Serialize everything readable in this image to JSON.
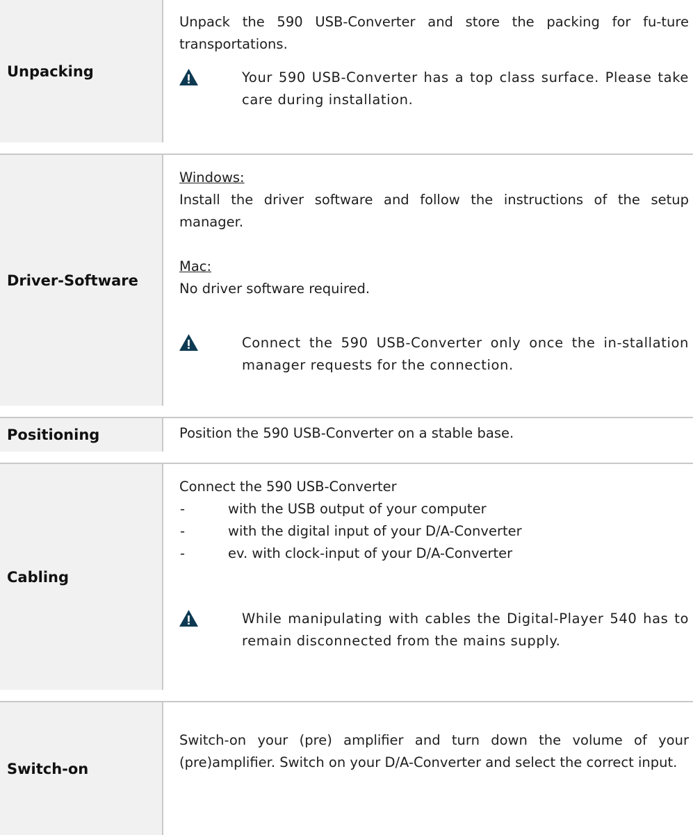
{
  "sections": {
    "unpacking": {
      "title": "Unpacking",
      "text": "Unpack the 590 USB-Converter and store the packing for fu-ture transportations.",
      "warning": "Your 590 USB-Converter has a top class surface. Please take care during installation."
    },
    "driver": {
      "title": "Driver-Software",
      "windows_label": "Windows:",
      "windows_text": "Install the driver software and follow the instructions of the setup manager.",
      "mac_label": "Mac:",
      "mac_text": "No driver software required.",
      "warning": "Connect the 590 USB-Converter only once the in-stallation manager requests for the connection."
    },
    "positioning": {
      "title": "Positioning",
      "text": "Position the 590 USB-Converter on a stable base."
    },
    "cabling": {
      "title": "Cabling",
      "intro": "Connect the 590 USB-Converter",
      "items": [
        "with the USB output of your computer",
        "with the digital input of your D/A-Converter",
        "ev. with clock-input of your D/A-Converter"
      ],
      "warning": "While manipulating with cables the Digital-Player 540 has to remain disconnected from the mains supply."
    },
    "switchon": {
      "title": "Switch-on",
      "text": "Switch-on your (pre) amplifier and turn down the volume of your (pre)amplifier. Switch on your D/A-Converter and select the correct input."
    }
  },
  "bullet_marker": "-",
  "icon_color": "#0d3a52"
}
